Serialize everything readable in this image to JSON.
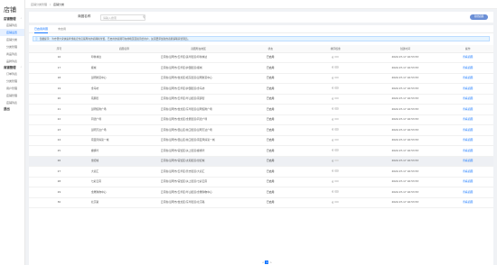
{
  "sidebar": {
    "logo": "店铺",
    "groups": [
      {
        "label": "店铺管理",
        "items": [
          {
            "label": "店铺列表",
            "active": false
          },
          {
            "label": "店铺设置",
            "active": true
          },
          {
            "label": "店铺分类",
            "active": false
          },
          {
            "label": "分类管理",
            "active": false
          },
          {
            "label": "商品列表",
            "active": false
          },
          {
            "label": "品牌列表",
            "active": false
          }
        ]
      },
      {
        "label": "商铺管理",
        "items": [
          {
            "label": "订单列表",
            "active": false
          },
          {
            "label": "分类管理",
            "active": false
          },
          {
            "label": "用户管理",
            "active": false
          },
          {
            "label": "店铺管理",
            "active": false
          },
          {
            "label": "店铺列表",
            "active": false
          }
        ]
      },
      {
        "label": "退出",
        "items": []
      }
    ]
  },
  "breadcrumb": {
    "parent": "店铺分类管理",
    "sep": "/",
    "current": "店铺分类"
  },
  "search": {
    "label": "商圈名称",
    "placeholder": "请输入搜索",
    "add_label": "新增商圈"
  },
  "tabs": [
    "已启用商圈",
    "未启用"
  ],
  "notice": "温馨提示：为方便大家快速查找和定位店铺所在的商圈和位置，已启用的商圈可在前端页面展示给用户。如需要添加新的商圈请联系管理员。",
  "table": {
    "headers": [
      "序号",
      "商圈名称",
      "商圈所在地区",
      "状态",
      "排序权重",
      "创建时间",
      "操作"
    ],
    "rows": [
      {
        "id": "16",
        "name": "印象林达",
        "region": "云南省/昆明市/五华区/莲华街道/印象林达",
        "status": "已启用",
        "weight": "0",
        "time": "2022-07-17 16:53:53",
        "op": "查看商圈",
        "hl": false
      },
      {
        "id": "17",
        "name": "顺城",
        "region": "云南省/昆明市/五华区/护国街道/顺城",
        "status": "已启用",
        "weight": "0",
        "time": "2022-07-17 16:53:53",
        "op": "查看商圈",
        "hl": false
      },
      {
        "id": "18",
        "name": "昆明财富中心",
        "region": "云南省/昆明市/盘龙区/拓东街道/昆明财富中心",
        "status": "已启用",
        "weight": "0",
        "time": "2022-07-17 16:53:53",
        "op": "查看商圈",
        "hl": false
      },
      {
        "id": "19",
        "name": "金马坊",
        "region": "云南省/昆明市/五华区/护国街道/金马坊",
        "status": "已启用",
        "weight": "0",
        "time": "2022-07-17 16:53:53",
        "op": "查看商圈",
        "hl": false
      },
      {
        "id": "20",
        "name": "南屏街",
        "region": "云南省/昆明市/五华区/华山街道/南屏街",
        "status": "已启用",
        "weight": "0",
        "time": "2022-07-17 16:53:53",
        "op": "查看商圈",
        "hl": false
      },
      {
        "id": "21",
        "name": "昆明恒隆广场",
        "region": "云南省/昆明市/盘龙区/东华街道/昆明恒隆广场",
        "status": "已启用",
        "weight": "0",
        "time": "2022-07-17 16:53:53",
        "op": "查看商圈",
        "hl": false
      },
      {
        "id": "22",
        "name": "同德广场",
        "region": "云南省/昆明市/盘龙区/金辰街道/同德广场",
        "status": "已启用",
        "weight": "0",
        "time": "2022-07-17 16:53:53",
        "op": "查看商圈",
        "hl": false
      },
      {
        "id": "23",
        "name": "昆明万达广场",
        "region": "云南省/昆明市/西山区/前卫街道/昆明万达广场",
        "status": "已启用",
        "weight": "0",
        "time": "2022-07-17 16:53:53",
        "op": "查看商圈",
        "hl": false
      },
      {
        "id": "24",
        "name": "南亚风情第一城",
        "region": "云南省/昆明市/西山区/前卫街道/南亚风情第一城",
        "status": "已启用",
        "weight": "0",
        "time": "2022-07-17 16:53:53",
        "op": "查看商圈",
        "hl": false
      },
      {
        "id": "25",
        "name": "螺蛳湾",
        "region": "云南省/昆明市/官渡区/关上街道/螺蛳湾",
        "status": "已启用",
        "weight": "0",
        "time": "2022-07-17 16:53:53",
        "op": "查看商圈",
        "hl": false
      },
      {
        "id": "26",
        "name": "世纪城",
        "region": "云南省/昆明市/官渡区/太和街道/世纪城",
        "status": "已启用",
        "weight": "0",
        "time": "2022-07-17 16:53:53",
        "op": "查看商圈",
        "hl": true
      },
      {
        "id": "27",
        "name": "大商汇",
        "region": "云南省/昆明市/五华区/普吉街道/大商汇",
        "status": "已启用",
        "weight": "0",
        "time": "2022-07-17 16:53:53",
        "op": "查看商圈",
        "hl": false
      },
      {
        "id": "28",
        "name": "七彩云南",
        "region": "云南省/昆明市/官渡区/关上街道/七彩云南",
        "status": "已启用",
        "weight": "0",
        "time": "2022-07-17 16:53:53",
        "op": "查看商圈",
        "hl": false
      },
      {
        "id": "29",
        "name": "金鹰购物中心",
        "region": "云南省/昆明市/五华区/华山街道/金鹰购物中心",
        "status": "已启用",
        "weight": "0",
        "time": "2022-07-17 16:53:53",
        "op": "查看商圈",
        "hl": false
      },
      {
        "id": "30",
        "name": "北京路",
        "region": "云南省/昆明市/盘龙区/东华街道/北京路",
        "status": "已启用",
        "weight": "0",
        "time": "2022-07-17 16:53:53",
        "op": "查看商圈",
        "hl": false
      }
    ]
  },
  "pager": {
    "prev": "<",
    "current": "1",
    "next": ">"
  },
  "colors": {
    "accent": "#1677ff",
    "add_button": "#6b8fd6",
    "row_highlight": "#eef0f4"
  }
}
